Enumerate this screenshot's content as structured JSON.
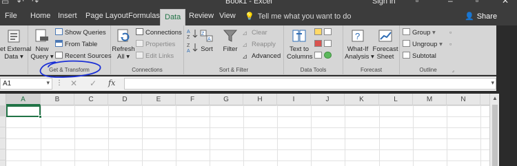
{
  "titlebar": {
    "title": "Book1 - Excel",
    "signin": "Sign in",
    "qat_icons": [
      "save-icon",
      "undo-icon",
      "redo-icon"
    ]
  },
  "tabs": [
    {
      "label": "File"
    },
    {
      "label": "Home"
    },
    {
      "label": "Insert"
    },
    {
      "label": "Page Layout"
    },
    {
      "label": "Formulas"
    },
    {
      "label": "Data",
      "active": true
    },
    {
      "label": "Review"
    },
    {
      "label": "View"
    }
  ],
  "tellme": "Tell me what you want to do",
  "share": "Share",
  "ribbon": {
    "get_transform": {
      "label": "Get & Transform",
      "get_external_1": "et External",
      "get_external_2": "Data",
      "new_query_1": "New",
      "new_query_2": "Query",
      "show_queries": "Show Queries",
      "from_table": "From Table",
      "recent_sources": "Recent Sources"
    },
    "connections": {
      "label": "Connections",
      "refresh_1": "Refresh",
      "refresh_2": "All",
      "connections": "Connections",
      "properties": "Properties",
      "edit_links": "Edit Links"
    },
    "sort_filter": {
      "label": "Sort & Filter",
      "sort": "Sort",
      "filter": "Filter",
      "clear": "Clear",
      "reapply": "Reapply",
      "advanced": "Advanced"
    },
    "data_tools": {
      "label": "Data Tools",
      "text_to_columns_1": "Text to",
      "text_to_columns_2": "Columns"
    },
    "forecast": {
      "label": "Forecast",
      "what_if_1": "What-If",
      "what_if_2": "Analysis",
      "forecast_sheet_1": "Forecast",
      "forecast_sheet_2": "Sheet"
    },
    "outline": {
      "label": "Outline",
      "group": "Group",
      "ungroup": "Ungroup",
      "subtotal": "Subtotal"
    }
  },
  "formula_bar": {
    "name_box": "A1",
    "fx": "fx",
    "value": ""
  },
  "grid": {
    "columns": [
      "A",
      "B",
      "C",
      "D",
      "E",
      "F",
      "G",
      "H",
      "I",
      "J",
      "K",
      "L",
      "M",
      "N"
    ],
    "selected_column": "A",
    "active_cell": "A1"
  },
  "colors": {
    "accent": "#217346",
    "annotation": "#1a2fd6"
  }
}
